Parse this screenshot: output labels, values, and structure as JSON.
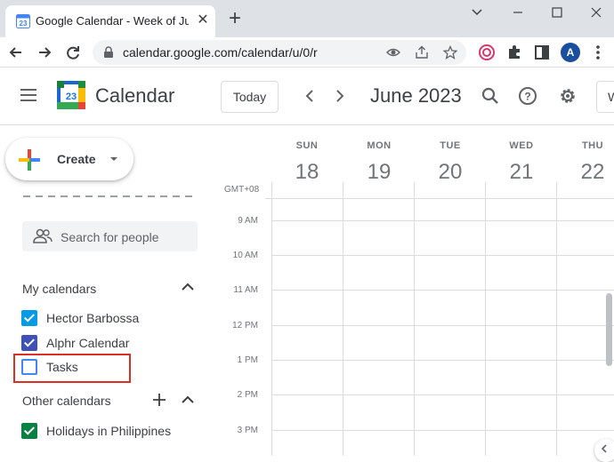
{
  "browser": {
    "tab_title": "Google Calendar - Week of June",
    "url": "calendar.google.com/calendar/u/0/r",
    "profile_initial": "A"
  },
  "app": {
    "name": "Calendar",
    "logo_day": "23",
    "today_label": "Today",
    "month_label": "June 2023",
    "create_label": "Create",
    "view_partial": "W"
  },
  "sidebar": {
    "search_placeholder": "Search for people",
    "my_calendars_title": "My calendars",
    "my_calendars": [
      {
        "name": "Hector Barbossa",
        "checked": true,
        "color": "#039be5"
      },
      {
        "name": "Alphr Calendar",
        "checked": true,
        "color": "#3f51b5"
      },
      {
        "name": "Tasks",
        "checked": false,
        "color": "#4285f4"
      }
    ],
    "other_calendars_title": "Other calendars",
    "other_calendars": [
      {
        "name": "Holidays in Philippines",
        "checked": true,
        "color": "#0b8043"
      }
    ],
    "highlight_color": "#d93025"
  },
  "grid": {
    "timezone": "GMT+08",
    "days": [
      {
        "name": "SUN",
        "num": "18"
      },
      {
        "name": "MON",
        "num": "19"
      },
      {
        "name": "TUE",
        "num": "20"
      },
      {
        "name": "WED",
        "num": "21"
      },
      {
        "name": "THU",
        "num": "22"
      }
    ],
    "times": [
      "9 AM",
      "10 AM",
      "11 AM",
      "12 PM",
      "1 PM",
      "2 PM",
      "3 PM"
    ]
  }
}
